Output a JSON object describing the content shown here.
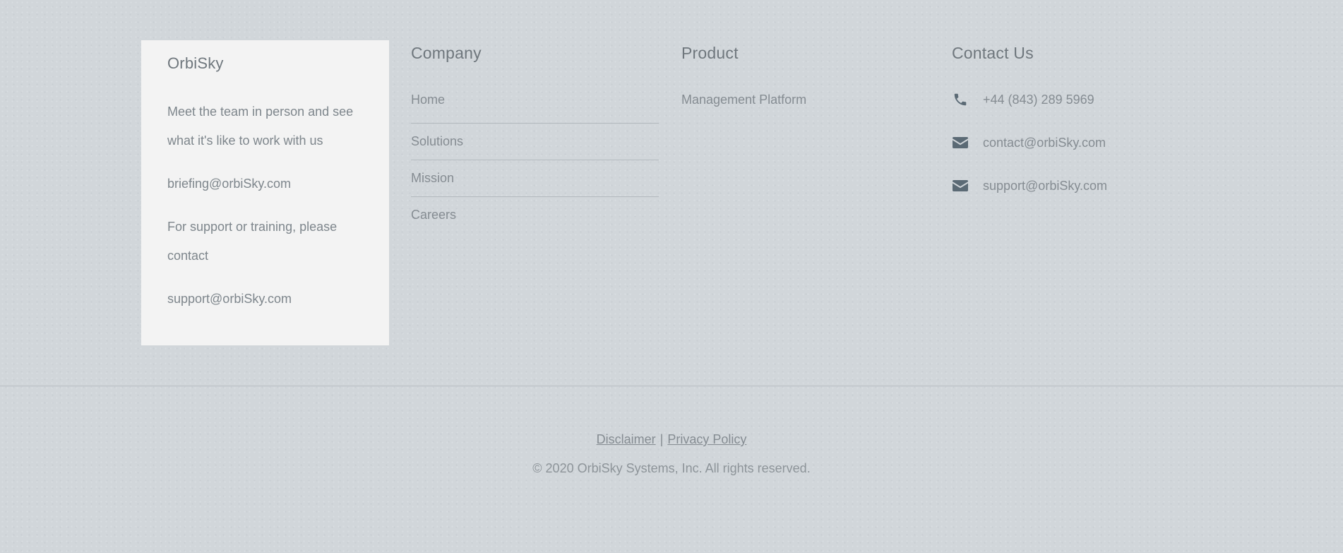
{
  "about": {
    "title": "OrbiSky",
    "intro": "Meet the team in person and see what it's like to work with us",
    "email": "briefing@orbiSky.com",
    "support_text": "For support or training, please contact",
    "support_email": "support@orbiSky.com"
  },
  "company": {
    "title": "Company",
    "items": [
      {
        "label": "Home"
      },
      {
        "label": "Solutions"
      },
      {
        "label": "Mission"
      },
      {
        "label": "Careers"
      }
    ]
  },
  "product": {
    "title": "Product",
    "items": [
      {
        "label": "Management Platform"
      }
    ]
  },
  "contact": {
    "title": "Contact Us",
    "phone": "+44 (843) 289 5969",
    "email": "contact@orbiSky.com",
    "support_email": "support@orbiSky.com",
    "icons": {
      "phone": "phone-icon",
      "email": "envelope-icon"
    },
    "icon_color": "#5b6a75"
  },
  "legal": {
    "disclaimer": "Disclaimer",
    "separator": "|",
    "privacy": "Privacy Policy",
    "copyright": "© 2020 OrbiSky Systems, Inc. All rights reserved."
  }
}
